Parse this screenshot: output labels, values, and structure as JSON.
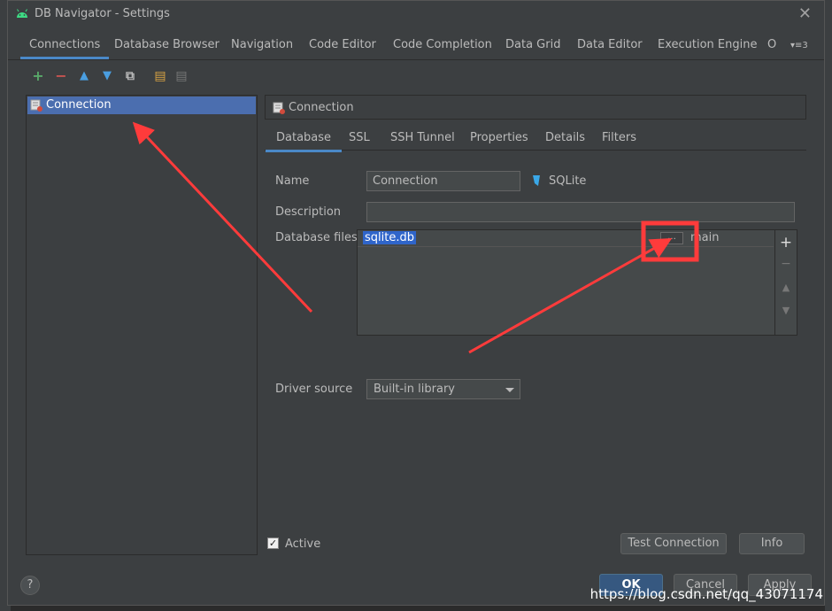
{
  "window": {
    "title": "DB Navigator - Settings"
  },
  "tabs": [
    "Connections",
    "Database Browser",
    "Navigation",
    "Code Editor",
    "Code Completion",
    "Data Grid",
    "Data Editor",
    "Execution Engine",
    "O"
  ],
  "tabs_overflow": "▾≡3",
  "connections": {
    "items": [
      {
        "label": "Connection",
        "selected": true
      }
    ]
  },
  "connection_panel": {
    "header": "Connection",
    "subtabs": [
      "Database",
      "SSL",
      "SSH Tunnel",
      "Properties",
      "Details",
      "Filters"
    ],
    "name_label": "Name",
    "name_value": "Connection",
    "db_type": "SQLite",
    "description_label": "Description",
    "description_value": "",
    "files_label": "Database files",
    "file_path": "sqlite.db",
    "file_browse": "...",
    "file_schema": "main",
    "driver_label": "Driver source",
    "driver_value": "Built-in library",
    "active_label": "Active",
    "active_checked": true,
    "test_button": "Test Connection",
    "info_button": "Info"
  },
  "footer": {
    "help": "?",
    "ok": "OK",
    "cancel": "Cancel",
    "apply": "Apply"
  },
  "watermark": "https://blog.csdn.net/qq_43071174",
  "colors": {
    "accent": "#4a88c7",
    "selection": "#4b6eaf",
    "annotation": "#ff3b3b"
  }
}
